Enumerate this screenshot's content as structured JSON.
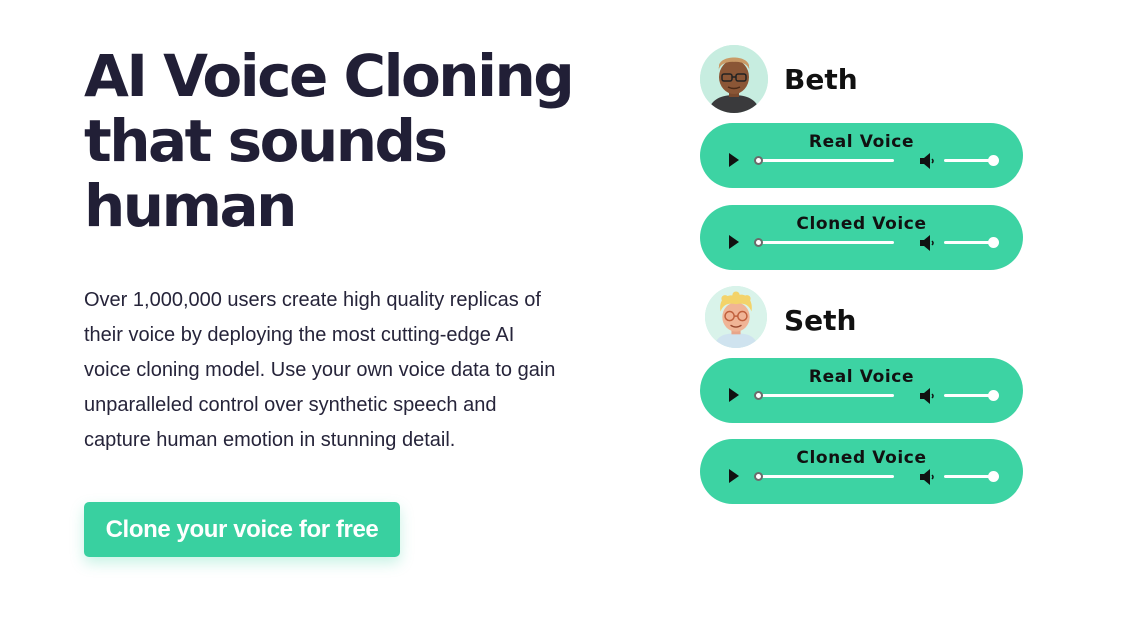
{
  "hero": {
    "title_lines": [
      "AI Voice Cloning",
      "that sounds",
      "human"
    ],
    "description_lines": [
      "Over 1,000,000 users create high quality replicas of",
      "their voice by deploying the most cutting-edge AI",
      "voice cloning model. Use your own voice data to gain",
      "unparalleled control over synthetic speech  and",
      "capture human emotion in stunning detail."
    ],
    "cta_label": "Clone your voice for free"
  },
  "speakers": [
    {
      "name": "Beth",
      "players": [
        {
          "label": "Real Voice",
          "progress": 0.0,
          "volume": 1.0
        },
        {
          "label": "Cloned Voice",
          "progress": 0.0,
          "volume": 1.0
        }
      ]
    },
    {
      "name": "Seth",
      "players": [
        {
          "label": "Real Voice",
          "progress": 0.0,
          "volume": 1.0
        },
        {
          "label": "Cloned Voice",
          "progress": 0.0,
          "volume": 1.0
        }
      ]
    }
  ],
  "icons": {
    "play": "play-icon",
    "volume": "volume-icon"
  },
  "colors": {
    "accent": "#3dd3a3",
    "cta": "#39d0a0",
    "heading": "#211f36",
    "body_text": "#26243a"
  }
}
